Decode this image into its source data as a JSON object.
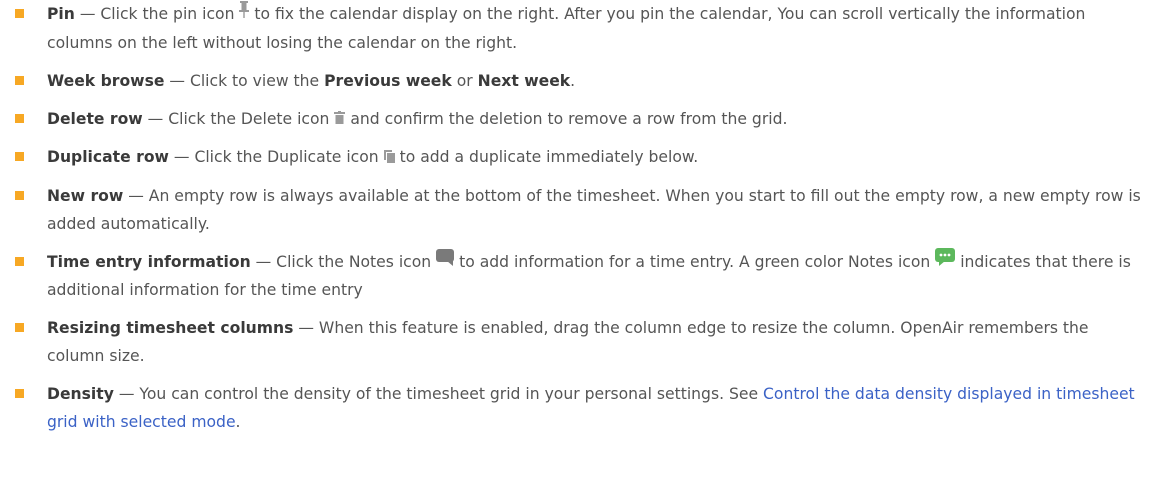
{
  "items": [
    {
      "term": "Pin",
      "t1": " — Click the pin icon ",
      "icon": "pin-icon",
      "t2": " to fix the calendar display on the right. After you pin the calendar, You can scroll vertically the information columns on the left without losing the calendar on the right."
    },
    {
      "term": "Week browse",
      "t1": " — Click to view the ",
      "b1": "Previous week",
      "t2": " or ",
      "b2": "Next week",
      "t3": "."
    },
    {
      "term": "Delete row",
      "t1": " — Click the Delete icon ",
      "icon": "trash-icon",
      "t2": " and confirm the deletion to remove a row from the grid."
    },
    {
      "term": "Duplicate row",
      "t1": " — Click the Duplicate icon ",
      "icon": "duplicate-icon",
      "t2": " to add a duplicate immediately below."
    },
    {
      "term": "New row",
      "t1": " — An empty row is always available at the bottom of the timesheet. When you start to fill out the empty row, a new empty row is added automatically."
    },
    {
      "term": "Time entry information",
      "t1": " — Click the Notes icon ",
      "icon": "notes-icon",
      "t2": " to add information for a time entry. A green color Notes icon ",
      "icon2": "notes-green-icon",
      "t3": " indicates that there is additional information for the time entry"
    },
    {
      "term": "Resizing timesheet columns",
      "t1": " — When this feature is enabled, drag the column edge to resize the column. OpenAir remembers the column size."
    },
    {
      "term": "Density",
      "t1": " — You can control the density of the timesheet grid in your personal settings. See ",
      "link": "Control the data density displayed in timesheet grid with selected mode",
      "t2": "."
    }
  ],
  "colors": {
    "bullet": "#f7a824",
    "link": "#3b62c6",
    "icon_gray": "#9a9a9a",
    "notes_green": "#5cb85c"
  }
}
